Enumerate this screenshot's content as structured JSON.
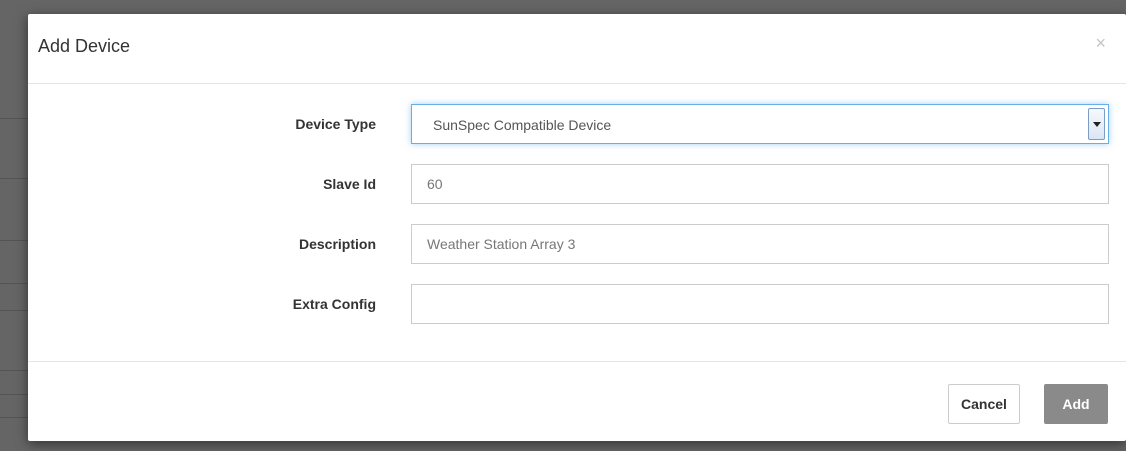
{
  "dialog": {
    "title": "Add Device",
    "close_glyph": "×",
    "close_icon": "close-icon"
  },
  "form": {
    "device_type": {
      "label": "Device Type",
      "selected_value": "SunSpec Compatible Device"
    },
    "slave_id": {
      "label": "Slave Id",
      "value": "60"
    },
    "description": {
      "label": "Description",
      "value": "Weather Station Array 3"
    },
    "extra_config": {
      "label": "Extra Config",
      "value": ""
    }
  },
  "footer": {
    "cancel_label": "Cancel",
    "add_label": "Add"
  },
  "colors": {
    "overlay": "#656565",
    "focus_border": "#66afe9",
    "add_button": "#8a8a8a"
  }
}
